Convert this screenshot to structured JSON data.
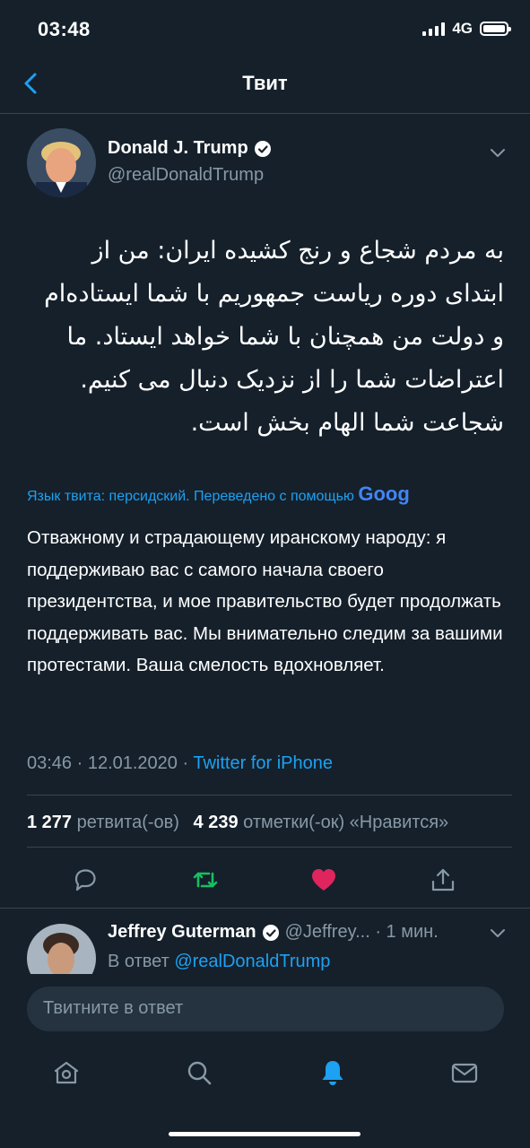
{
  "status": {
    "time": "03:48",
    "network": "4G"
  },
  "nav": {
    "title": "Твит",
    "back_icon": "chevron-left-icon"
  },
  "tweet": {
    "author_name": "Donald J. Trump",
    "author_handle": "@realDonaldTrump",
    "text_original": "به مردم شجاع و رنج کشیده ایران: من از ابتدای دوره ریاست جمهوریم با شما ایستاده‌ام و دولت من همچنان با شما خواهد ایستاد. ما اعتراضات شما را از نزدیک دنبال می کنیم. شجاعت شما الهام بخش است.",
    "translation_note": "Язык твита: персидский. Переведено с помощью",
    "translation_provider": "Goog",
    "text_translated": "Отважному и страдающему иранскому народу: я поддерживаю вас с самого начала своего президентства, и мое правительство будет продолжать поддерживать вас. Мы внимательно следим за вашими протестами. Ваша смелость вдохновляет.",
    "timestamp": "03:46 · 12.01.2020 · ",
    "source": "Twitter for iPhone",
    "retweets_count": "1 277",
    "retweets_label": "ретвита(-ов)",
    "likes_count": "4 239",
    "likes_label": "отметки(-ок) «Нравится»"
  },
  "actions": [
    "reply-icon",
    "retweet-icon",
    "like-icon",
    "share-icon"
  ],
  "colors": {
    "accent": "#1da1f2",
    "retweet": "#17bf63",
    "like": "#e0245e",
    "background": "#15202b"
  },
  "reply": {
    "author_name": "Jeffrey Guterman",
    "author_handle": "@Jeffrey... · 1 мин.",
    "reply_prefix": "В ответ ",
    "reply_target": "@realDonaldTrump"
  },
  "compose": {
    "placeholder": "Твитните в ответ"
  },
  "tabs": [
    "home-icon",
    "search-icon",
    "notifications-icon",
    "messages-icon"
  ]
}
